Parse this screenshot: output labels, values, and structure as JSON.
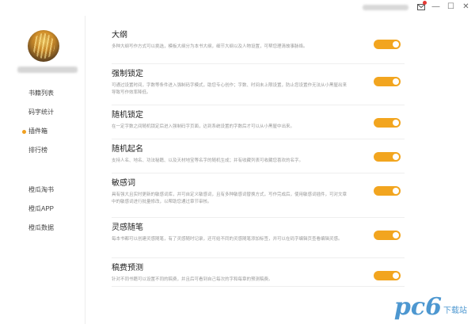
{
  "window": {
    "controls": {
      "notice_icon": "mail-notice-icon",
      "minimize": "—",
      "maximize": "☐",
      "close": "✕"
    }
  },
  "sidebar": {
    "nav_primary": [
      {
        "label": "书籍列表",
        "active": false
      },
      {
        "label": "码字统计",
        "active": false
      },
      {
        "label": "插件箱",
        "active": true
      },
      {
        "label": "排行榜",
        "active": false
      }
    ],
    "nav_secondary": [
      {
        "label": "橙瓜淘书"
      },
      {
        "label": "橙瓜APP"
      },
      {
        "label": "橙瓜数据"
      }
    ]
  },
  "settings": [
    {
      "title": "大纲",
      "desc": "多种大纲写作方式可以挑选，模板大纲分为本书大纲，细节大纲以及人物设置，可帮您理清故事脉络。",
      "enabled": true
    },
    {
      "title": "强制锁定",
      "desc": "可通过设置时间，字数等条件进入强制码字模式，助您专心创作；字数、时间未上限设置，防止您设置作无法从小黑屋出来导致写作效率降低。",
      "enabled": true
    },
    {
      "title": "随机锁定",
      "desc": "在一定字数之间随机锁定后进入强制码字页面，达到系统设置的字数后才可以从小黑屋中出来。",
      "enabled": true
    },
    {
      "title": "随机起名",
      "desc": "支持人名、地名、功法秘籍、以及天材地宝等名字的随机生成；并有收藏列表可收藏您喜欢的名字。",
      "enabled": true
    },
    {
      "title": "敏感词",
      "desc": "具有强大且实时更新的敏感词库，并可自定义敏感词，且有多种敏感词替换方式，写作完成后，使用敏感词插件，可对文章中的敏感词进行批量修改，以帮助您通过章节审核。",
      "enabled": true
    },
    {
      "title": "灵感随笔",
      "desc": "每本书都可以创建灵感随笔，有了灵感随时记录，还可给不同的灵感随笔添加标签，并可以在码字编辑页查看编辑灵感。",
      "enabled": true
    },
    {
      "title": "稿费预测",
      "desc": "针对不同书籍可以设置不同的稿费，并且后可看到自己每次的字和每章的预测稿费。",
      "enabled": true
    }
  ],
  "colors": {
    "accent": "#f2a51f",
    "watermark": "#2f86c8"
  },
  "watermark": {
    "big": "pc6",
    "small": "下载站"
  }
}
